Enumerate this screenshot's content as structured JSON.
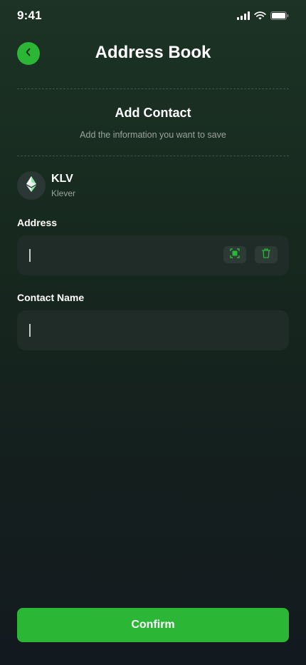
{
  "status_bar": {
    "time": "9:41"
  },
  "header": {
    "title": "Address Book",
    "back_icon": "chevron-left-icon"
  },
  "section": {
    "title": "Add Contact",
    "subtitle": "Add the information you want to save"
  },
  "token": {
    "symbol": "KLV",
    "name": "Klever",
    "icon": "ethereum-icon"
  },
  "address_field": {
    "label": "Address",
    "value": "",
    "placeholder": "",
    "scan_icon": "scan-qr-icon",
    "clear_icon": "trash-icon"
  },
  "contact_name_field": {
    "label": "Contact Name",
    "value": "",
    "placeholder": ""
  },
  "confirm_button": {
    "label": "Confirm"
  },
  "colors": {
    "accent": "#2bb636",
    "field_bg": "#1f2c28",
    "muted_text": "#9aa3a0"
  }
}
